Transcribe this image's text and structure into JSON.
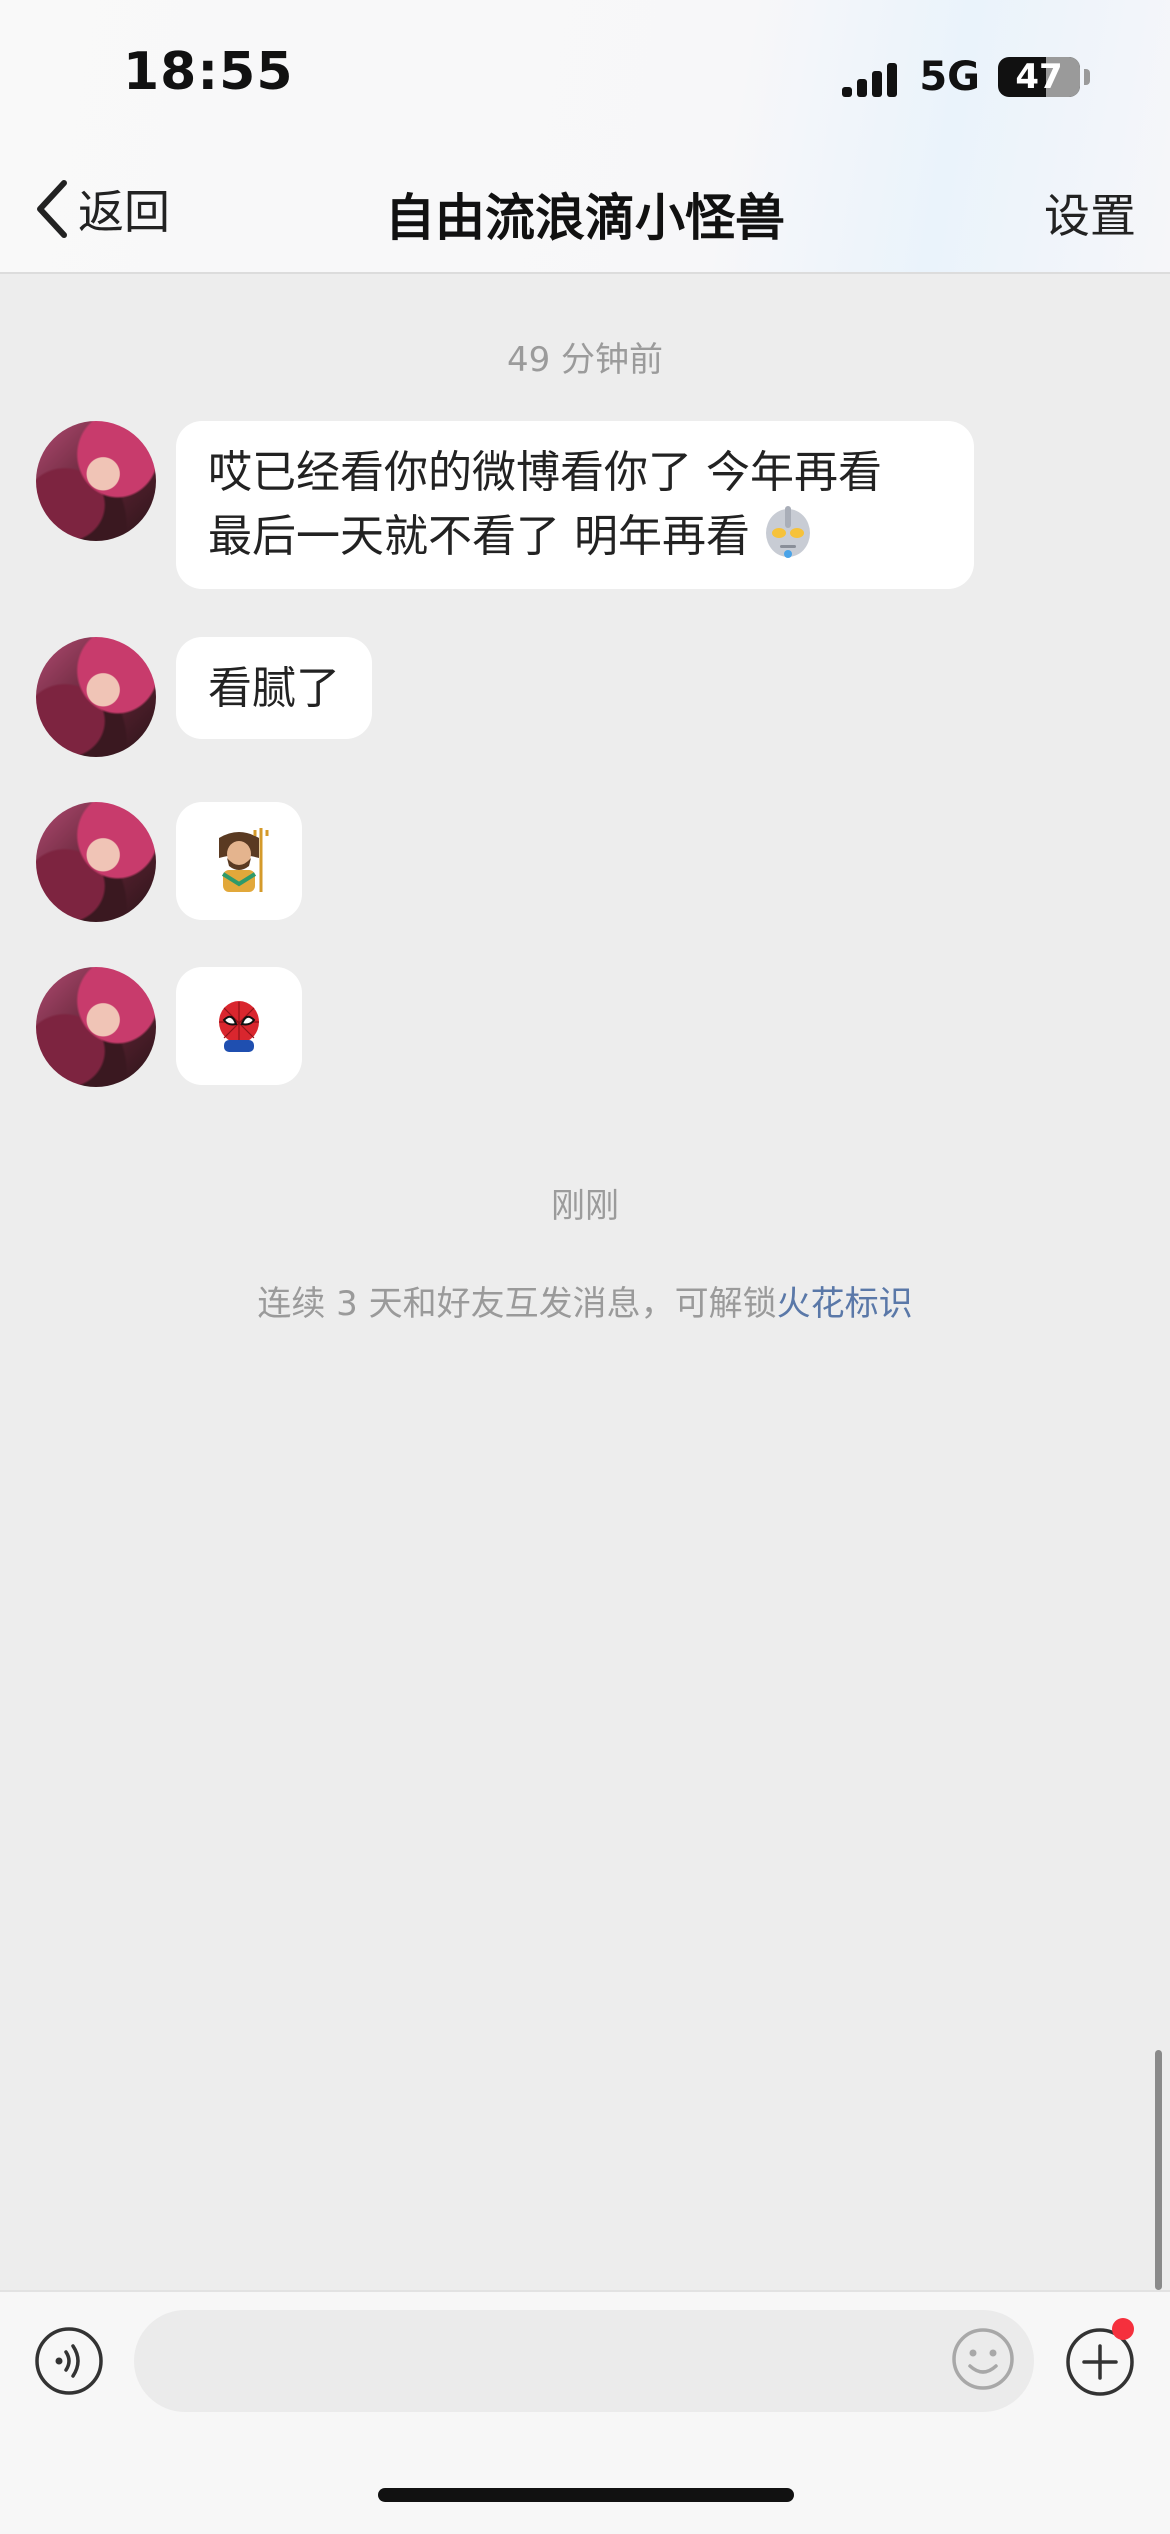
{
  "status_bar": {
    "time": "18:55",
    "network": "5G",
    "battery": "47"
  },
  "nav": {
    "back_label": "返回",
    "title": "自由流浪滴小怪兽",
    "settings_label": "设置"
  },
  "chat": {
    "timestamp_1": "49 分钟前",
    "messages": [
      {
        "line1": "哎已经看你的微博看你了 今年再看",
        "line2": "最后一天就不看了 明年再看",
        "emoji": "ultraman-emoji"
      },
      {
        "text": "看腻了"
      },
      {
        "emoji": "aquaman-emoji"
      },
      {
        "emoji": "spiderman-emoji"
      }
    ],
    "timestamp_2": "刚刚",
    "streak_note": "连续 3 天和好友互发消息，可解锁",
    "streak_link": "火花标识"
  },
  "input_bar": {
    "placeholder": "",
    "voice_icon": "voice-icon",
    "emoji_icon": "smiley-icon",
    "plus_icon": "plus-icon",
    "badge_color": "#f5303d"
  }
}
